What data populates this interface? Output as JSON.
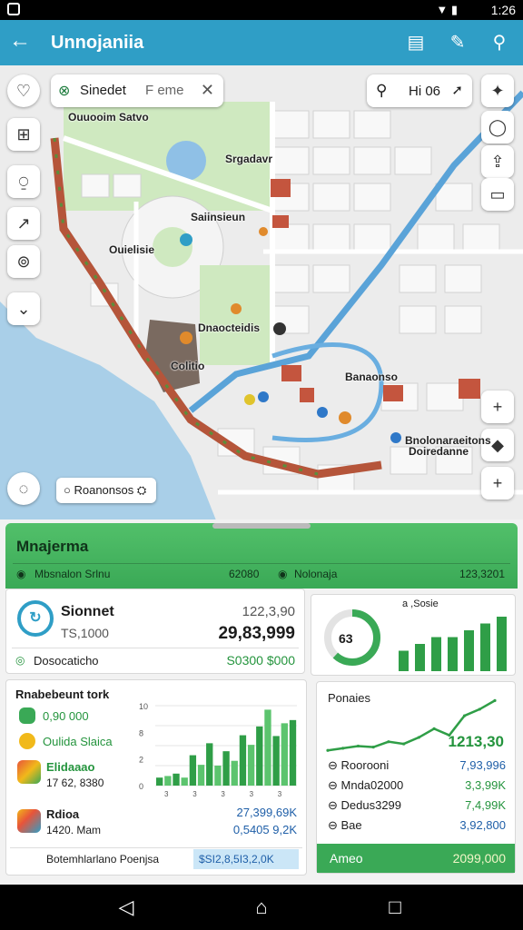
{
  "status": {
    "time": "1:26"
  },
  "appbar": {
    "title": "Unnojaniia",
    "back_icon": "arrow-left-icon",
    "actions": [
      "newspaper-icon",
      "edit-icon",
      "search-person-icon"
    ]
  },
  "map": {
    "search": {
      "value": "Sinedet",
      "placeholder": "F eme"
    },
    "search_right": {
      "value": "Hi 06"
    },
    "labels": [
      "Ouuooim Satvo",
      "Srgadavr",
      "Saiinsieun",
      "Ouielisie",
      "Dnaocteidis",
      "Colitio",
      "Banaonso",
      "Bnolonaraeitons",
      "Doiredanne"
    ],
    "chip_label": "Roanonsos",
    "accent_road": "#5aa3d8",
    "route": "#b5553a"
  },
  "sheet": {
    "header_title": "Mnajerma",
    "header_left": "Mbsnalon Srlnu",
    "header_mid": "62080",
    "header_right_label": "Nolonaja",
    "header_right_value": "123,3201",
    "card1": {
      "name": "Sionnet",
      "sub": "TS,1000",
      "v1": "122,3,90",
      "v2": "29,83,999",
      "foot_label": "Dosocaticho",
      "foot_value": "S0300 $000"
    },
    "gauge": {
      "label": "63",
      "title": "a ,Sosie",
      "value_frac": 0.62
    },
    "bars_small": {
      "values": [
        3,
        4,
        5,
        5,
        6,
        7,
        8
      ]
    },
    "card2": {
      "title": "Rnabebeunt tork",
      "items": [
        {
          "icon": "money-icon",
          "label": "0,90 000",
          "sub": ""
        },
        {
          "icon": "coin-icon",
          "label": "Oulida Slaica",
          "sub": ""
        },
        {
          "icon": "app-icon",
          "label": "Elidaaao",
          "sub": "17 62, 8380"
        },
        {
          "icon": "color-app-icon",
          "label": "Rdioa",
          "sub": "1420. Mam"
        }
      ],
      "right_vals": [
        "27,399,69K",
        "0,5405 9,2K"
      ],
      "footer_label": "Botemhlarlano Poenjsa",
      "footer_value": "$SI2,8,5I3,2,0K"
    },
    "chart_mid": {
      "yticks": [
        "10",
        "8",
        "2",
        "0"
      ],
      "xticks": [
        "3",
        "3",
        "3",
        "3",
        "3"
      ]
    },
    "card3": {
      "title": "Ponaies",
      "big_value": "1213,30",
      "rows": [
        {
          "label": "Roorooni",
          "value": "7,93,996"
        },
        {
          "label": "Mnda02000",
          "value": "3,3,99K"
        },
        {
          "label": "Dedus3299",
          "value": "7,4,99K"
        },
        {
          "label": "Bae",
          "value": "3,92,800"
        }
      ],
      "footer_label": "Ameo",
      "footer_value": "2099,000"
    }
  },
  "chart_data": [
    {
      "type": "bar",
      "categories": [
        "1",
        "2",
        "3",
        "4",
        "5",
        "6",
        "7"
      ],
      "values": [
        3,
        4,
        5,
        5,
        6,
        7,
        8
      ],
      "title": "a ,Sosie",
      "xlabel": "",
      "ylabel": ""
    },
    {
      "type": "bar",
      "categories": [
        "1",
        "2",
        "3",
        "4",
        "5",
        "6",
        "7",
        "8",
        "9",
        "10",
        "11",
        "12",
        "13",
        "14",
        "15",
        "16",
        "17"
      ],
      "values": [
        1,
        1.2,
        1.5,
        1,
        3.8,
        2.6,
        5.3,
        2.5,
        4.3,
        3.1,
        6.3,
        5.1,
        7.4,
        9.5,
        6.2,
        7.8,
        8.2
      ],
      "title": "",
      "xlabel": "",
      "ylabel": "",
      "ylim": [
        0,
        10
      ]
    },
    {
      "type": "line",
      "x": [
        1,
        2,
        3,
        4,
        5,
        6,
        7,
        8,
        9,
        10,
        11,
        12
      ],
      "series": [
        {
          "values": [
            1.0,
            1.1,
            1.2,
            1.15,
            1.4,
            1.3,
            1.6,
            2.0,
            1.7,
            2.6,
            2.9,
            3.3
          ]
        }
      ],
      "title": "Ponaies",
      "xlabel": "",
      "ylabel": ""
    }
  ]
}
